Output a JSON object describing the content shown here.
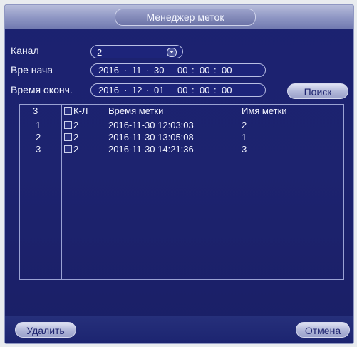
{
  "window": {
    "title": "Менеджер меток"
  },
  "form": {
    "channel_label": "Канал",
    "channel_value": "2",
    "start_label": "Вре нача",
    "start_date": {
      "year": "2016",
      "month": "11",
      "day": "30"
    },
    "start_time": {
      "h": "00",
      "m": "00",
      "s": "00"
    },
    "end_label": "Время оконч.",
    "end_date": {
      "year": "2016",
      "month": "12",
      "day": "01"
    },
    "end_time": {
      "h": "00",
      "m": "00",
      "s": "00"
    },
    "search_label": "Поиск"
  },
  "table": {
    "count": "3",
    "headers": {
      "channel": "К-Л",
      "mark_time": "Время метки",
      "mark_name": "Имя метки"
    },
    "rows": [
      {
        "num": "1",
        "channel": "2",
        "time": "2016-11-30 12:03:03",
        "name": "2"
      },
      {
        "num": "2",
        "channel": "2",
        "time": "2016-11-30 13:05:08",
        "name": "1"
      },
      {
        "num": "3",
        "channel": "2",
        "time": "2016-11-30 14:21:36",
        "name": "3"
      }
    ]
  },
  "footer": {
    "delete_label": "Удалить",
    "cancel_label": "Отмена"
  },
  "icons": {
    "dropdown": "dropdown-arrow-icon",
    "checkbox": "checkbox-icon"
  },
  "colors": {
    "panel": "#1d236f",
    "accent": "#b7bddb",
    "text": "#f1f3ff"
  }
}
